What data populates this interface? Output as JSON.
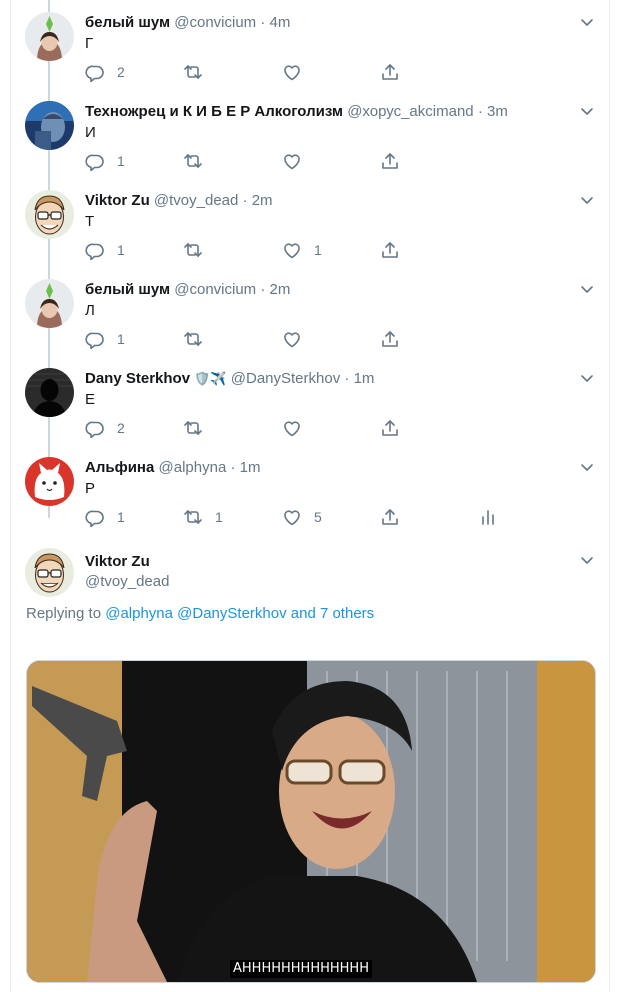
{
  "thread": [
    {
      "name": "белый шум",
      "handle": "@convicium",
      "time": "4m",
      "text": "Г",
      "avatar": "avatar-sims",
      "actions": {
        "replies": "2",
        "retweets": "",
        "likes": "",
        "stats": false
      }
    },
    {
      "name": "Техножрец и К И Б Е Р Алкоголизм",
      "handle": "@хорус_akcimand",
      "time": "3m",
      "text": "И",
      "avatar": "avatar-blue-portrait",
      "actions": {
        "replies": "1",
        "retweets": "",
        "likes": "",
        "stats": false
      }
    },
    {
      "name": "Viktor Zu",
      "handle": "@tvoy_dead",
      "time": "2m",
      "text": "Т",
      "avatar": "avatar-cartoon-man",
      "actions": {
        "replies": "1",
        "retweets": "",
        "likes": "1",
        "stats": false
      }
    },
    {
      "name": "белый шум",
      "handle": "@convicium",
      "time": "2m",
      "text": "Л",
      "avatar": "avatar-sims",
      "actions": {
        "replies": "1",
        "retweets": "",
        "likes": "",
        "stats": false
      }
    },
    {
      "name": "Dany Sterkhov",
      "emoji": "🛡️✈️",
      "handle": "@DanySterkhov",
      "time": "1m",
      "text": "Е",
      "avatar": "avatar-dark-silhouette",
      "actions": {
        "replies": "2",
        "retweets": "",
        "likes": "",
        "stats": false
      }
    },
    {
      "name": "Альфина",
      "handle": "@alphyna",
      "time": "1m",
      "text": "Р",
      "avatar": "avatar-white-fox",
      "actions": {
        "replies": "1",
        "retweets": "1",
        "likes": "5",
        "stats": true
      }
    }
  ],
  "main_tweet": {
    "name": "Viktor Zu",
    "handle": "@tvoy_dead",
    "replying_prefix": "Replying to",
    "replying_links": "@alphyna @DanySterkhov and 7 others",
    "media_caption": "АННННННННННННН"
  },
  "dot": "·",
  "colors": {
    "link": "#1b95e0",
    "muted": "#657786",
    "thread_line": "#ccd6dd"
  }
}
